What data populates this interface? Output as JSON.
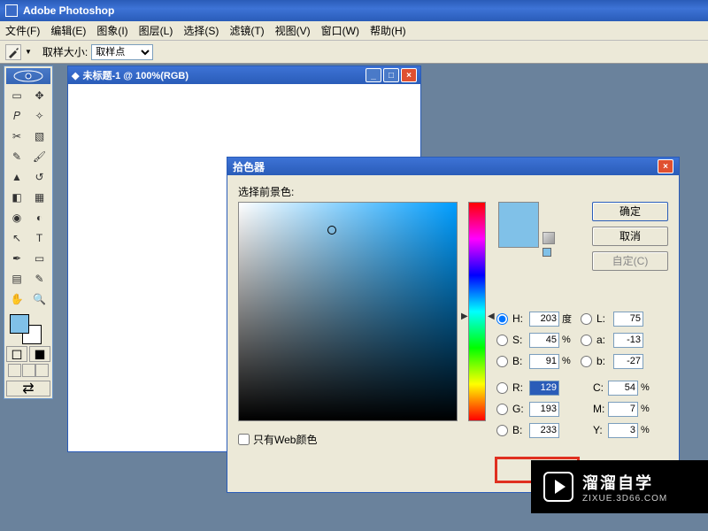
{
  "app": {
    "title": "Adobe Photoshop"
  },
  "menu": {
    "file": "文件(F)",
    "edit": "编辑(E)",
    "image": "图象(I)",
    "layer": "图层(L)",
    "select": "选择(S)",
    "filter": "滤镜(T)",
    "view": "视图(V)",
    "window": "窗口(W)",
    "help": "帮助(H)"
  },
  "options": {
    "sample_label": "取样大小:",
    "sample_value": "取样点"
  },
  "doc": {
    "title": "未标题-1 @ 100%(RGB)"
  },
  "swatches": {
    "fg": "#80c1e8",
    "bg": "#ffffff"
  },
  "picker": {
    "title": "拾色器",
    "label": "选择前景色:",
    "ok": "确定",
    "cancel": "取消",
    "custom": "自定(C)",
    "web_only": "只有Web颜色",
    "H": "203",
    "H_unit": "度",
    "S": "45",
    "S_unit": "%",
    "Bv": "91",
    "Bv_unit": "%",
    "L": "75",
    "a": "-13",
    "b": "-27",
    "R": "129",
    "G": "193",
    "Bb": "233",
    "C": "54",
    "M": "7",
    "Y": "3",
    "pct": "%"
  },
  "labels": {
    "H": "H:",
    "S": "S:",
    "B": "B:",
    "L": "L:",
    "a": "a:",
    "b": "b:",
    "R": "R:",
    "G": "G:",
    "Bb": "B:",
    "C": "C:",
    "M": "M:",
    "Y": "Y:"
  },
  "watermark": {
    "line1": "溜溜自学",
    "line2": "ZIXUE.3D66.COM"
  }
}
